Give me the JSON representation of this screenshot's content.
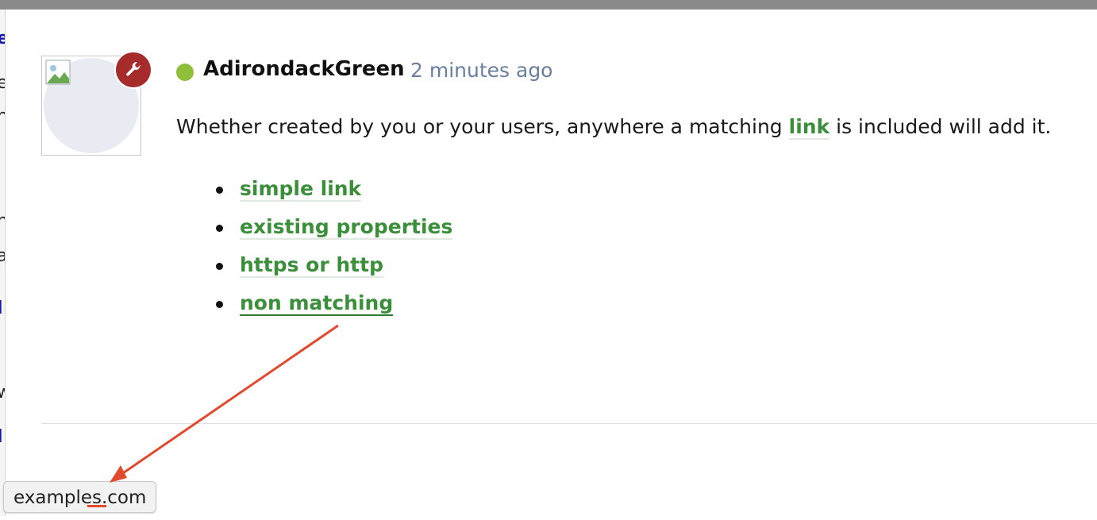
{
  "post": {
    "username": "AdirondackGreen",
    "timestamp": "2 minutes ago",
    "text_before": "Whether created by you or your users, anywhere a matching ",
    "inline_link": "link",
    "text_after": " is included will add it.",
    "links": [
      "simple link",
      "existing properties",
      "https or http",
      "non matching"
    ]
  },
  "status_bar": {
    "url": "examples.com"
  },
  "colors": {
    "link": "#3b8f3b",
    "online": "#8fbf3a",
    "staff_badge": "#a62b2b",
    "annotation": "#e14a2f"
  },
  "icons": {
    "badge": "wrench-icon",
    "avatar": "broken-image-icon"
  }
}
